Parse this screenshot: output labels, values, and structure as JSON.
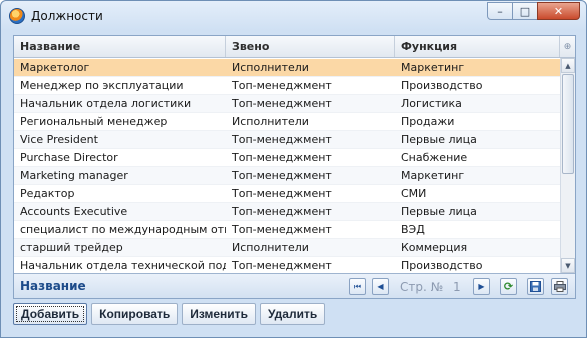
{
  "window": {
    "title": "Должности",
    "controls": {
      "minimize": "–",
      "maximize": "□",
      "close": "✕"
    }
  },
  "grid": {
    "columns": [
      "Название",
      "Звено",
      "Функция"
    ],
    "corner_icon": "⊕",
    "rows": [
      [
        "Маркетолог",
        "Исполнители",
        "Маркетинг"
      ],
      [
        "Менеджер по эксплуатации",
        "Топ-менеджмент",
        "Производство"
      ],
      [
        "Начальник отдела логистики",
        "Топ-менеджмент",
        "Логистика"
      ],
      [
        "Региональный менеджер",
        "Исполнители",
        "Продажи"
      ],
      [
        "Vice President",
        "Топ-менеджмент",
        "Первые лица"
      ],
      [
        "Purchase Director",
        "Топ-менеджмент",
        "Снабжение"
      ],
      [
        "Marketing manager",
        "Топ-менеджмент",
        "Маркетинг"
      ],
      [
        "Редактор",
        "Топ-менеджмент",
        "СМИ"
      ],
      [
        "Accounts Executive",
        "Топ-менеджмент",
        "Первые лица"
      ],
      [
        "специалист по международным отн…",
        "Топ-менеджмент",
        "ВЭД"
      ],
      [
        "старший трейдер",
        "Исполнители",
        "Коммерция"
      ],
      [
        "Начальник отдела технической под…",
        "Топ-менеджмент",
        "Производство"
      ]
    ],
    "selected_row": 0
  },
  "pager": {
    "field_label": "Название",
    "page_label": "Стр. №",
    "page_number": "1",
    "icons": {
      "first": "first-page-icon",
      "prev": "prev-page-icon",
      "next": "next-page-icon",
      "refresh": "refresh-icon",
      "save": "save-icon",
      "print": "print-icon"
    }
  },
  "actions": {
    "add": "Добавить",
    "copy": "Копировать",
    "edit": "Изменить",
    "delete": "Удалить"
  },
  "colors": {
    "selected_row": "#fbd8a6",
    "window_bg": "#cfe0f3",
    "pager_label": "#1d4b8a"
  }
}
